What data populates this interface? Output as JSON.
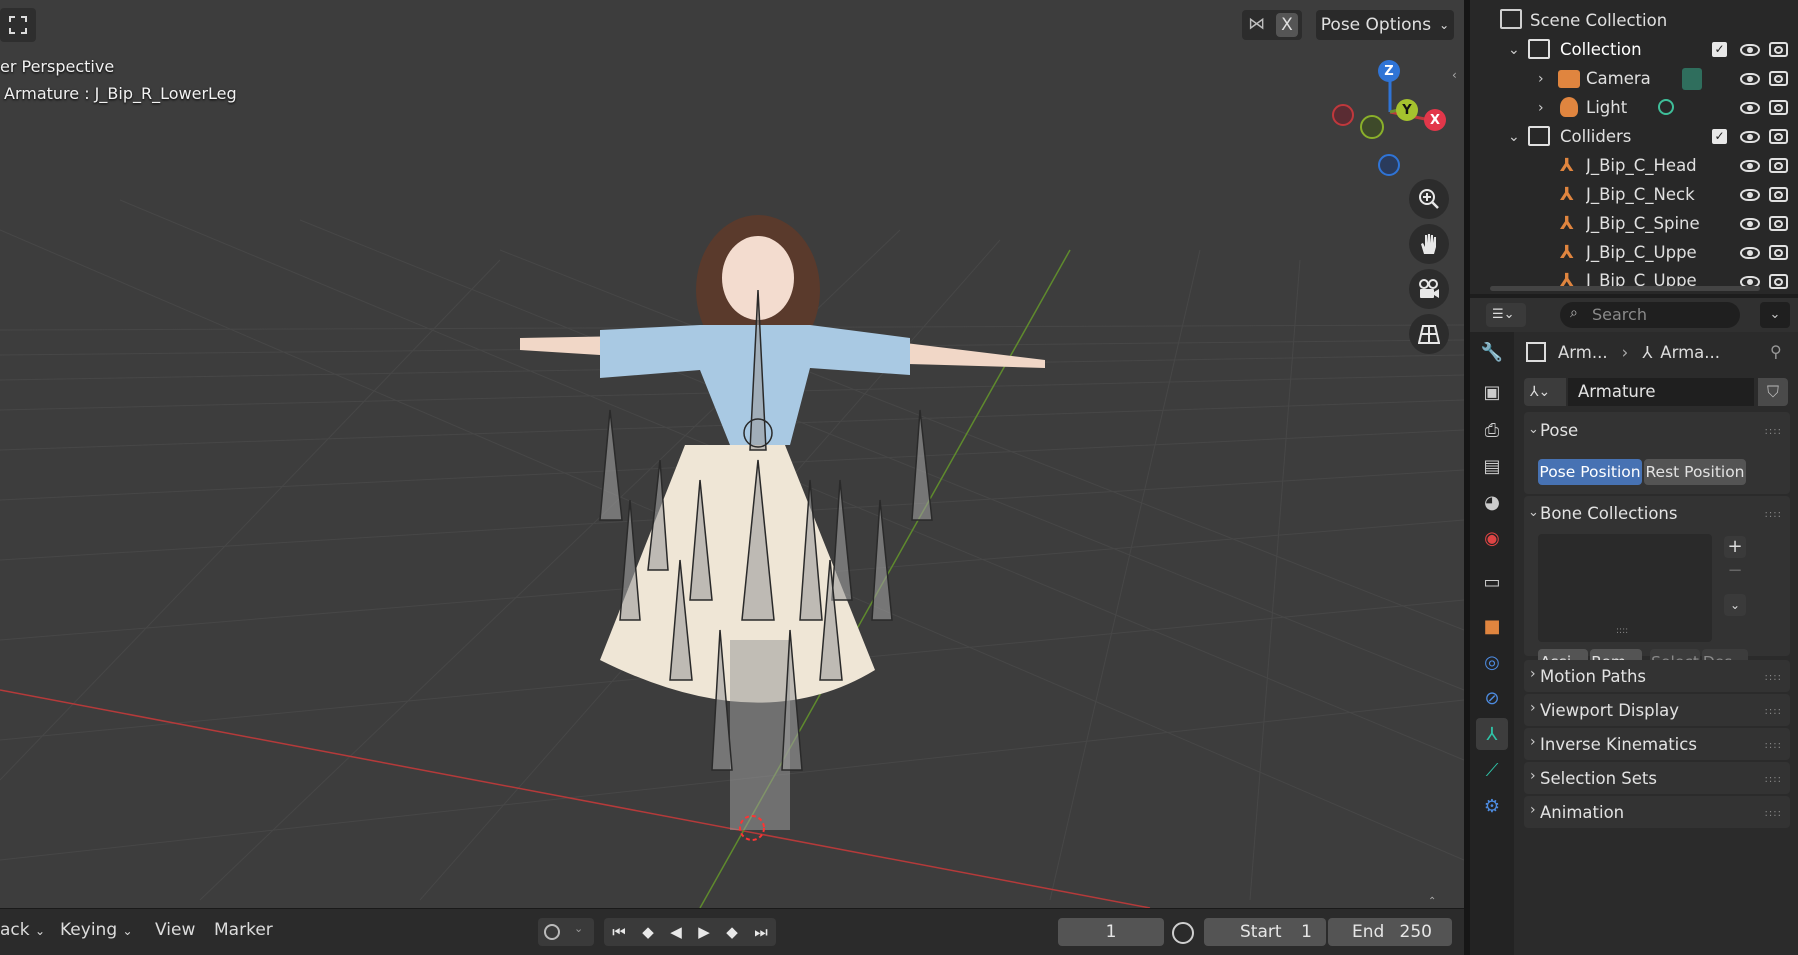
{
  "viewport": {
    "perspective_label": "er Perspective",
    "object_label": "Armature : J_Bip_R_LowerLeg",
    "x_button": "X",
    "pose_options": "Pose Options",
    "gizmo": {
      "z": "Z",
      "y": "Y",
      "x": "X"
    },
    "nav_icons": [
      "zoom-icon",
      "hand-pan-icon",
      "camera-view-icon",
      "grid-ortho-icon"
    ],
    "axis_colors": {
      "x": "#c0383c",
      "y": "#6c8f2e",
      "z": "#2f74d6"
    }
  },
  "timeline": {
    "playback": "ack",
    "keying": "Keying",
    "view": "View",
    "marker": "Marker",
    "current_frame": "1",
    "start_label": "Start",
    "start_value": "1",
    "end_label": "End",
    "end_value": "250"
  },
  "outliner": {
    "rows": [
      {
        "label": "Scene Collection"
      },
      {
        "label": "Collection"
      },
      {
        "label": "Camera"
      },
      {
        "label": "Light"
      },
      {
        "label": "Colliders"
      },
      {
        "label": "J_Bip_C_Head"
      },
      {
        "label": "J_Bip_C_Neck"
      },
      {
        "label": "J_Bip_C_Spine"
      },
      {
        "label": "J_Bip_C_Uppe"
      },
      {
        "label": "J_Bip_C_Uppe"
      }
    ]
  },
  "properties": {
    "search_placeholder": "Search",
    "breadcrumb": {
      "object": "Arm...",
      "data": "Arma..."
    },
    "datablock_name": "Armature",
    "pose_panel": {
      "title": "Pose",
      "pose_position": "Pose Position",
      "rest_position": "Rest Position"
    },
    "bone_collections": {
      "title": "Bone Collections",
      "assign": "Assi...",
      "remove": "Rem...",
      "select": "Select",
      "deselect": "Des..."
    },
    "collapsed_panels": [
      "Motion Paths",
      "Viewport Display",
      "Inverse Kinematics",
      "Selection Sets",
      "Animation"
    ],
    "accent_color": "#4772b3"
  }
}
